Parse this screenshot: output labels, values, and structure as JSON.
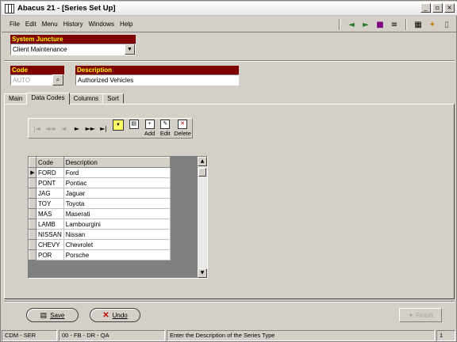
{
  "window": {
    "title": "Abacus 21 - [Series Set Up]"
  },
  "menu": [
    "File",
    "Edit",
    "Menu",
    "History",
    "Windows",
    "Help"
  ],
  "system_juncture": {
    "label": "System Juncture",
    "value": "Client Maintenance"
  },
  "code": {
    "label": "Code",
    "value": "AUTO"
  },
  "description": {
    "label": "Description",
    "value": "Authorized Vehicles"
  },
  "tabs": [
    {
      "label": "Main",
      "active": false
    },
    {
      "label": "Data Codes",
      "active": true
    },
    {
      "label": "Columns",
      "active": false
    },
    {
      "label": "Sort",
      "active": false
    }
  ],
  "nav_toolbar": {
    "add": "Add",
    "edit": "Edit",
    "delete": "Delete"
  },
  "grid": {
    "columns": [
      "Code",
      "Description"
    ],
    "rows": [
      [
        "FORD",
        "Ford"
      ],
      [
        "PONT",
        "Pontiac"
      ],
      [
        "JAG",
        "Jaguar"
      ],
      [
        "TOY",
        "Toyota"
      ],
      [
        "MAS",
        "Maserati"
      ],
      [
        "LAMB",
        "Lambourgini"
      ],
      [
        "NISSAN",
        "Nissan"
      ],
      [
        "CHEVY",
        "Chevrolet"
      ],
      [
        "POR",
        "Porsche"
      ]
    ]
  },
  "buttons": {
    "save": "Save",
    "undo": "Undo",
    "finish": "Finish"
  },
  "status": {
    "module": "CDM - SER",
    "context": "00 - FB - DR - QA",
    "message": "Enter the Description of the Series Type",
    "count": "1"
  }
}
